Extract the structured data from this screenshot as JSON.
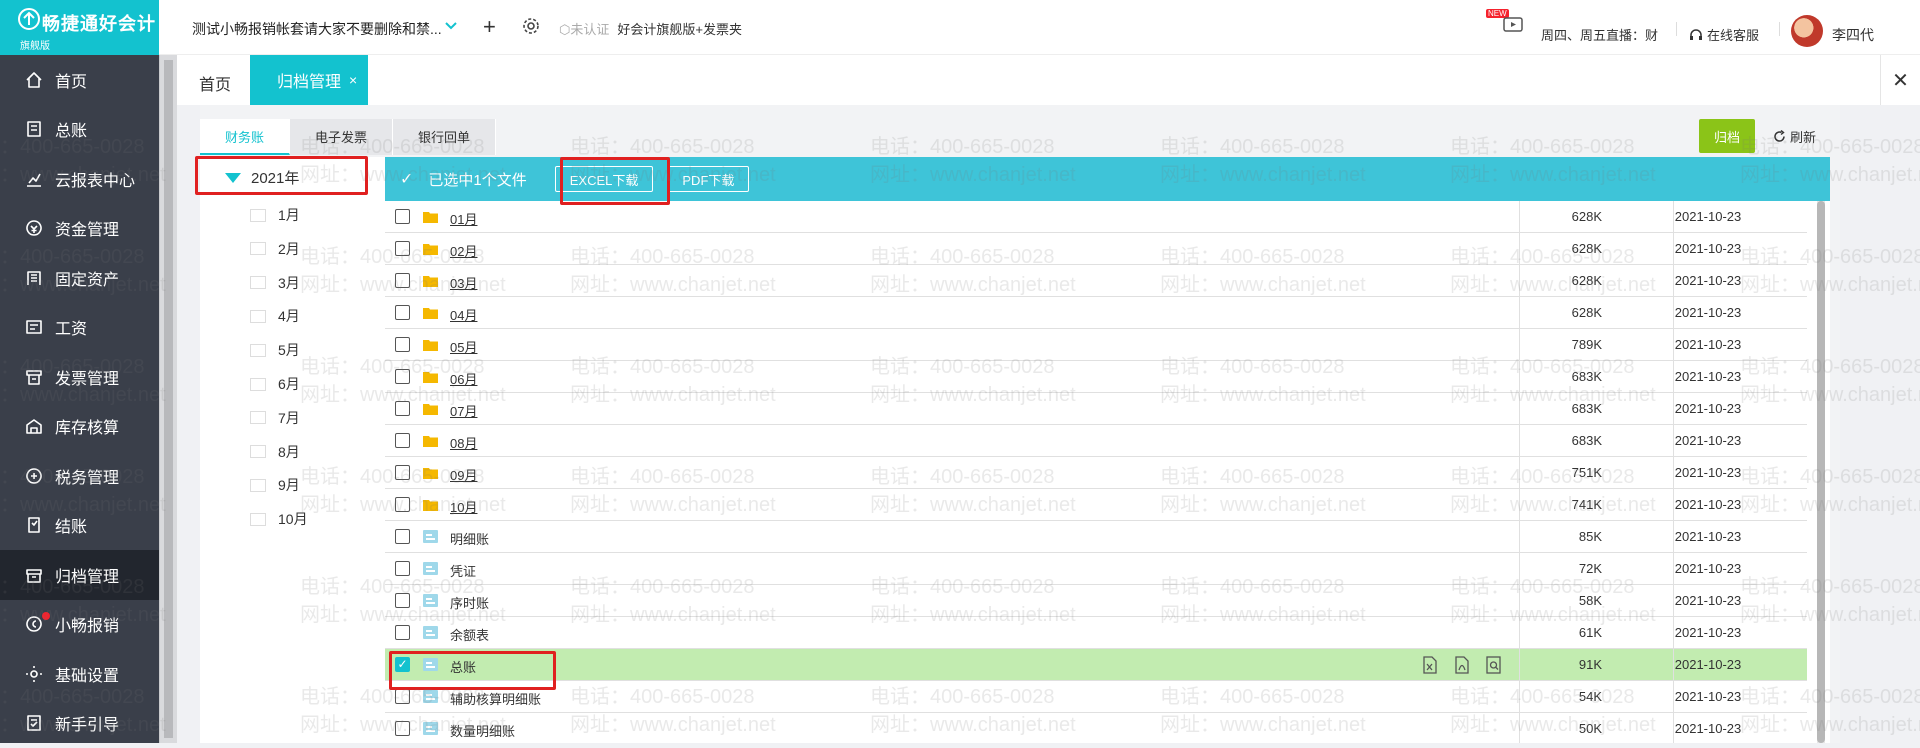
{
  "app": {
    "brand": "畅捷通好会计",
    "edition": "旗舰版"
  },
  "topbar": {
    "account_name": "测试小畅报销帐套请大家不要删除和禁...",
    "cert_status": "未认证",
    "product": "好会计旗舰版+发票夹",
    "new_badge": "NEW",
    "live_text": "周四、周五直播：财",
    "service": "在线客服",
    "user": "李四代"
  },
  "sidebar": {
    "items": [
      {
        "label": "首页",
        "icon": "home-icon"
      },
      {
        "label": "总账",
        "icon": "ledger-icon"
      },
      {
        "label": "云报表中心",
        "icon": "chart-icon"
      },
      {
        "label": "资金管理",
        "icon": "money-icon"
      },
      {
        "label": "固定资产",
        "icon": "building-icon"
      },
      {
        "label": "工资",
        "icon": "salary-icon"
      },
      {
        "label": "发票管理",
        "icon": "invoice-icon"
      },
      {
        "label": "库存核算",
        "icon": "warehouse-icon"
      },
      {
        "label": "税务管理",
        "icon": "tax-icon"
      },
      {
        "label": "结账",
        "icon": "close-books-icon"
      },
      {
        "label": "归档管理",
        "icon": "archive-icon",
        "active": true
      },
      {
        "label": "小畅报销",
        "icon": "reimburse-icon",
        "dot": true
      },
      {
        "label": "基础设置",
        "icon": "settings-icon"
      },
      {
        "label": "新手引导",
        "icon": "guide-icon"
      }
    ]
  },
  "tabs": {
    "home": "首页",
    "active": "归档管理",
    "close": "×"
  },
  "subtabs": [
    "财务账",
    "电子发票",
    "银行回单"
  ],
  "actions": {
    "archive": "归档",
    "refresh": "刷新"
  },
  "tree": {
    "year": "2021年",
    "months": [
      "1月",
      "2月",
      "3月",
      "4月",
      "5月",
      "6月",
      "7月",
      "8月",
      "9月",
      "10月"
    ]
  },
  "selection": {
    "check": "✓",
    "text": "已选中1个文件",
    "excel_download": "EXCEL下载",
    "pdf_download": "PDF下载"
  },
  "files": [
    {
      "name": "01月",
      "type": "folder",
      "size": "628K",
      "date": "2021-10-23"
    },
    {
      "name": "02月",
      "type": "folder",
      "size": "628K",
      "date": "2021-10-23"
    },
    {
      "name": "03月",
      "type": "folder",
      "size": "628K",
      "date": "2021-10-23"
    },
    {
      "name": "04月",
      "type": "folder",
      "size": "628K",
      "date": "2021-10-23"
    },
    {
      "name": "05月",
      "type": "folder",
      "size": "789K",
      "date": "2021-10-23"
    },
    {
      "name": "06月",
      "type": "folder",
      "size": "683K",
      "date": "2021-10-23"
    },
    {
      "name": "07月",
      "type": "folder",
      "size": "683K",
      "date": "2021-10-23"
    },
    {
      "name": "08月",
      "type": "folder",
      "size": "683K",
      "date": "2021-10-23"
    },
    {
      "name": "09月",
      "type": "folder",
      "size": "751K",
      "date": "2021-10-23"
    },
    {
      "name": "10月",
      "type": "folder",
      "size": "741K",
      "date": "2021-10-23"
    },
    {
      "name": "明细账",
      "type": "report",
      "size": "85K",
      "date": "2021-10-23"
    },
    {
      "name": "凭证",
      "type": "report",
      "size": "72K",
      "date": "2021-10-23"
    },
    {
      "name": "序时账",
      "type": "report",
      "size": "58K",
      "date": "2021-10-23"
    },
    {
      "name": "余额表",
      "type": "report",
      "size": "61K",
      "date": "2021-10-23"
    },
    {
      "name": "总账",
      "type": "report",
      "size": "91K",
      "date": "2021-10-23",
      "selected": true
    },
    {
      "name": "辅助核算明细账",
      "type": "report",
      "size": "54K",
      "date": "2021-10-23"
    },
    {
      "name": "数量明细账",
      "type": "report",
      "size": "50K",
      "date": "2021-10-23"
    }
  ],
  "watermark": {
    "phone": "电话：400-665-0028",
    "site": "网址：www.chanjet.net"
  },
  "colors": {
    "accent": "#13c2cf",
    "sidebar": "#3a3f4a",
    "archive_btn": "#8bc418",
    "selected_row": "#c2ecb0",
    "highlight": "#e02020"
  }
}
